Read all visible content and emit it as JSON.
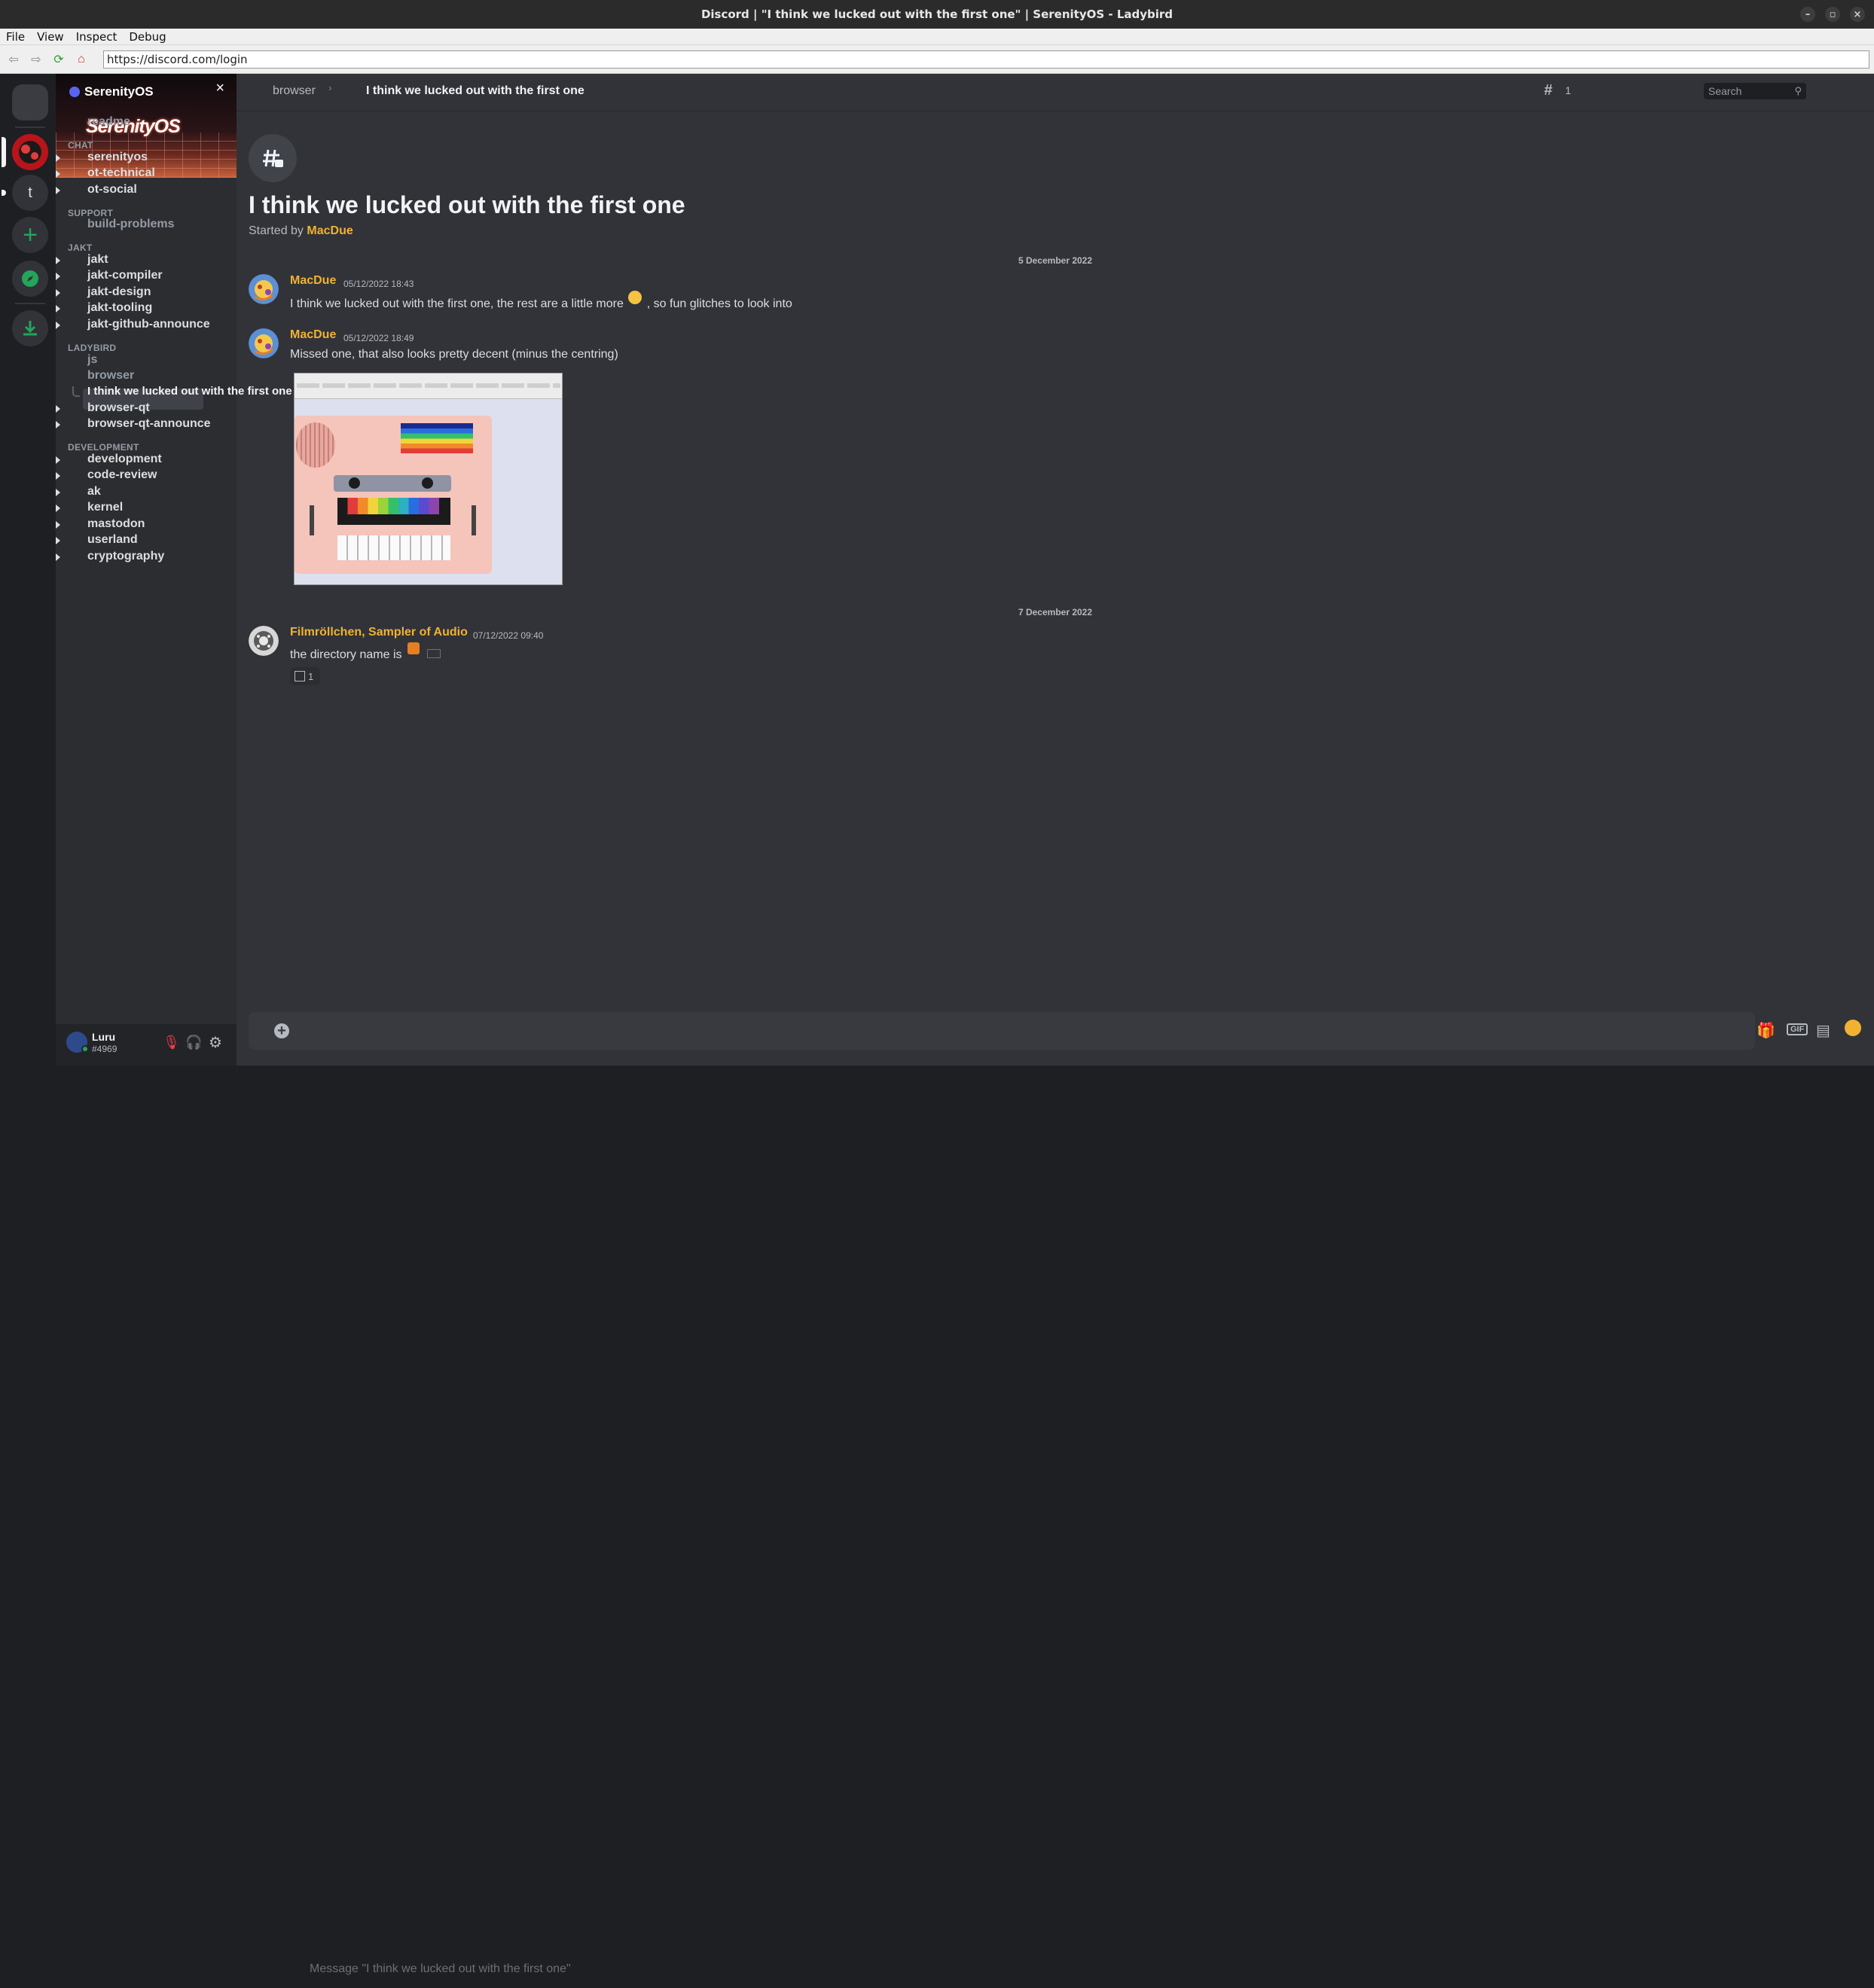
{
  "window": {
    "title": "Discord | \"I think we lucked out with the first one\" | SerenityOS - Ladybird",
    "controls": [
      "–",
      "▫",
      "×"
    ]
  },
  "menu": [
    "File",
    "View",
    "Inspect",
    "Debug"
  ],
  "browser": {
    "url": "https://discord.com/login"
  },
  "guilds": [
    {
      "label": "",
      "icon": "blank-server-icon"
    },
    {
      "label": "",
      "icon": "serenityos-server-icon",
      "selected": true
    },
    {
      "label": "t",
      "icon": "text-server-icon"
    },
    {
      "label": "+",
      "icon": "add-server-icon"
    },
    {
      "label": "",
      "icon": "compass-icon"
    },
    {
      "label": "",
      "icon": "download-icon"
    }
  ],
  "server": {
    "name": "SerenityOS",
    "banner_text": "SerenityOS",
    "close": "×"
  },
  "channels": {
    "top": [
      {
        "name": "readme",
        "muted": true
      }
    ],
    "categories": [
      {
        "name": "CHAT",
        "items": [
          {
            "name": "serenityos",
            "caret": true
          },
          {
            "name": "ot-technical",
            "caret": true
          },
          {
            "name": "ot-social",
            "caret": true
          }
        ]
      },
      {
        "name": "SUPPORT",
        "items": [
          {
            "name": "build-problems",
            "muted": true
          }
        ]
      },
      {
        "name": "JAKT",
        "items": [
          {
            "name": "jakt",
            "caret": true
          },
          {
            "name": "jakt-compiler",
            "caret": true
          },
          {
            "name": "jakt-design",
            "caret": true
          },
          {
            "name": "jakt-tooling",
            "caret": true
          },
          {
            "name": "jakt-github-announce",
            "caret": true
          }
        ]
      },
      {
        "name": "LADYBIRD",
        "items": [
          {
            "name": "js",
            "muted": true
          },
          {
            "name": "browser",
            "muted": true
          },
          {
            "name": "I think we lucked out with the first one",
            "thread": true,
            "selected": true
          },
          {
            "name": "browser-qt",
            "caret": true
          },
          {
            "name": "browser-qt-announce",
            "caret": true
          }
        ]
      },
      {
        "name": "DEVELOPMENT",
        "items": [
          {
            "name": "development",
            "caret": true
          },
          {
            "name": "code-review",
            "caret": true
          },
          {
            "name": "ak",
            "caret": true
          },
          {
            "name": "kernel",
            "caret": true
          },
          {
            "name": "mastodon",
            "caret": true
          },
          {
            "name": "userland",
            "caret": true
          },
          {
            "name": "cryptography",
            "caret": true
          }
        ]
      }
    ]
  },
  "user": {
    "name": "Luru",
    "tag": "#4969"
  },
  "header": {
    "parent": "browser",
    "thread": "I think we lucked out with the first one",
    "thread_count": "1",
    "search_placeholder": "Search"
  },
  "thread_intro": {
    "title": "I think we lucked out with the first one",
    "started_by_prefix": "Started by",
    "author": "MacDue"
  },
  "messages": [
    {
      "date": "5 December 2022"
    },
    {
      "author": "MacDue",
      "time": "05/12/2022 18:43",
      "text_before": "I think we lucked out with the first one, the rest are a little more",
      "text_after": ", so fun glitches to look into"
    },
    {
      "author": "MacDue",
      "time": "05/12/2022 18:49",
      "text": "Missed one, that also looks pretty decent (minus the centring)"
    },
    {
      "date": "7 December 2022"
    },
    {
      "author": "Filmröllchen, Sampler of Audio",
      "time": "07/12/2022 09:40",
      "text": "the directory name is",
      "reaction_count": "1"
    }
  ],
  "composer": {
    "placeholder": "Message \"I think we lucked out with the first one\""
  },
  "colors": {
    "accent": "#f0b232",
    "background": "#313338",
    "sidebar": "#2b2d31",
    "guilds": "#1e1f22",
    "brand": "#5865f2",
    "green": "#23a55a"
  }
}
